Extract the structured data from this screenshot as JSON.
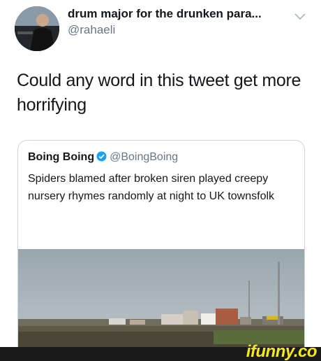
{
  "tweet": {
    "display_name": "drum major for the drunken para...",
    "handle": "@rahaeli",
    "text": "Could any word in this tweet get more horrifying"
  },
  "quoted_tweet": {
    "display_name": "Boing Boing",
    "handle": "@BoingBoing",
    "text": "Spiders blamed after broken siren played creepy nursery rhymes randomly at night to UK townsfolk",
    "verified": true
  },
  "watermark": {
    "text": "ifunny.co"
  },
  "icons": {
    "menu": "chevron-down-icon",
    "verified": "verified-badge-icon"
  },
  "colors": {
    "verified_blue": "#1da1f2",
    "secondary_text": "#657786",
    "watermark_yellow": "#f8e71c"
  }
}
